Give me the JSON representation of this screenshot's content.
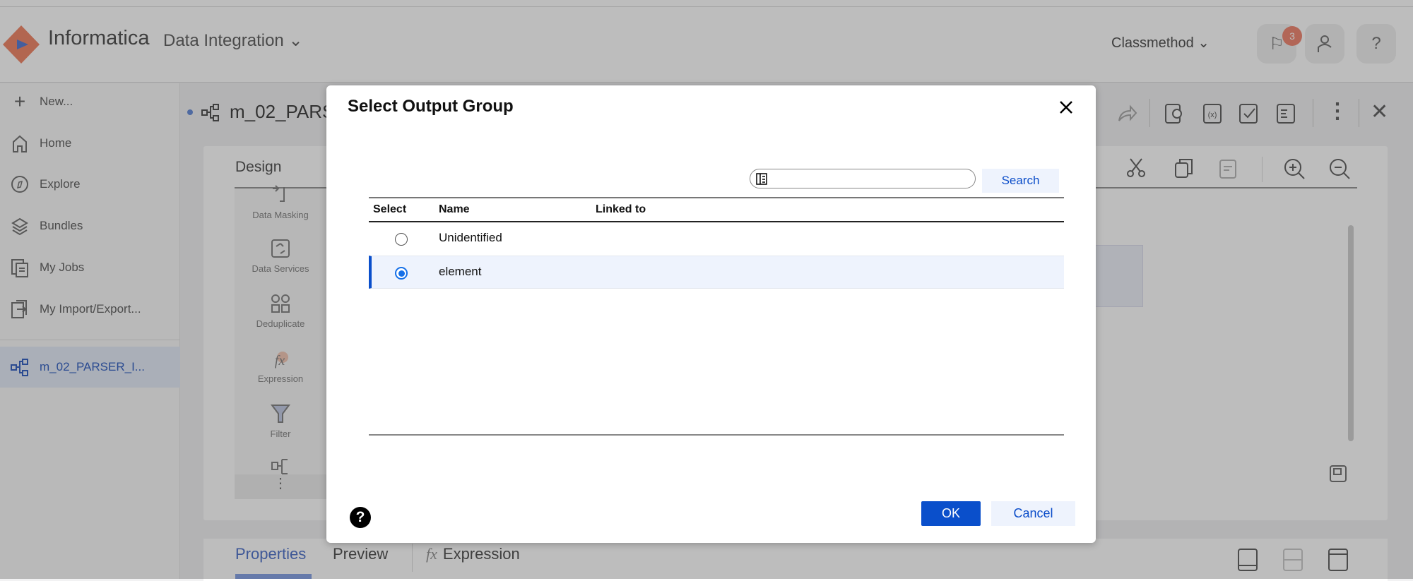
{
  "header": {
    "brand": "Informatica",
    "product": "Data Integration",
    "org": "Classmethod",
    "notification_count": "3",
    "help_label": "?"
  },
  "sidebar": {
    "items": [
      {
        "label": "New...",
        "icon": "plus-icon"
      },
      {
        "label": "Home",
        "icon": "home-icon"
      },
      {
        "label": "Explore",
        "icon": "compass-icon"
      },
      {
        "label": "Bundles",
        "icon": "layers-icon"
      },
      {
        "label": "My Jobs",
        "icon": "jobs-icon"
      },
      {
        "label": "My Import/Export...",
        "icon": "import-export-icon"
      }
    ],
    "open_mapping": "m_02_PARSER_I..."
  },
  "mapping": {
    "title": "m_02_PARS"
  },
  "design": {
    "label": "Design",
    "palette": [
      "Data Masking",
      "Data Services",
      "Deduplicate",
      "Expression",
      "Filter"
    ]
  },
  "bottom_tabs": [
    "Properties",
    "Preview",
    "Expression"
  ],
  "dialog": {
    "title": "Select Output Group",
    "search_value": "",
    "search_button": "Search",
    "columns": [
      "Select",
      "Name",
      "Linked to"
    ],
    "rows": [
      {
        "name": "Unidentified",
        "linked_to": "",
        "selected": false
      },
      {
        "name": "element",
        "linked_to": "",
        "selected": true
      }
    ],
    "ok": "OK",
    "cancel": "Cancel",
    "help": "?"
  },
  "colors": {
    "primary": "#0a4fcb",
    "selected_row": "#eef3fd",
    "radio": "#1670e8",
    "badge": "#f08a76"
  }
}
